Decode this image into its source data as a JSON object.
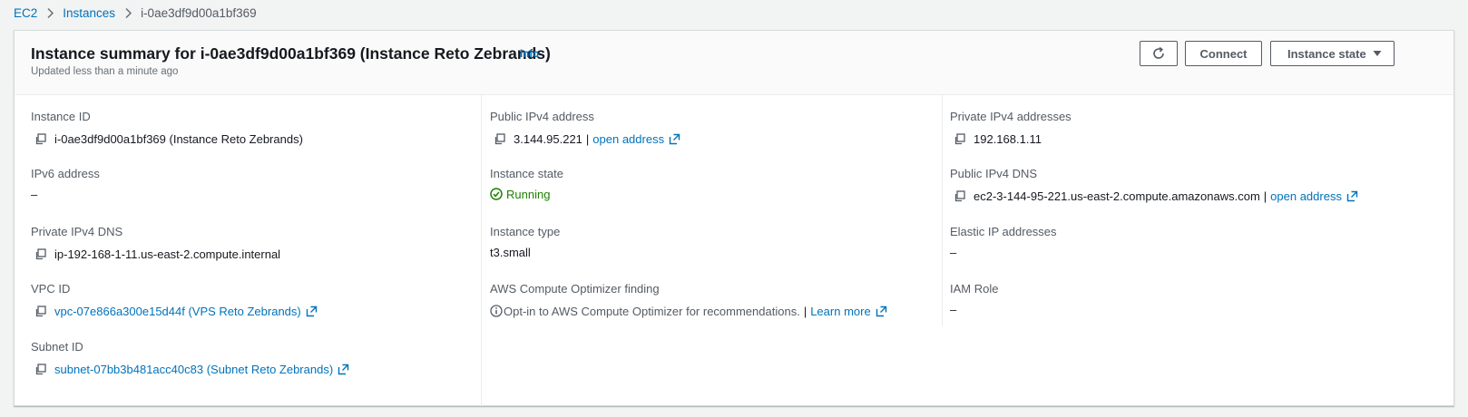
{
  "breadcrumb": {
    "items": [
      {
        "label": "EC2"
      },
      {
        "label": "Instances"
      }
    ],
    "current": "i-0ae3df9d00a1bf369"
  },
  "header": {
    "title": "Instance summary for i-0ae3df9d00a1bf369 (Instance Reto Zebrands)",
    "info_label": "Info",
    "subtitle": "Updated less than a minute ago",
    "connect_label": "Connect",
    "instance_state_label": "Instance state"
  },
  "details": {
    "instance_id": {
      "label": "Instance ID",
      "value": "i-0ae3df9d00a1bf369 (Instance Reto Zebrands)"
    },
    "ipv6": {
      "label": "IPv6 address",
      "value": "–"
    },
    "private_dns": {
      "label": "Private IPv4 DNS",
      "value": "ip-192-168-1-11.us-east-2.compute.internal"
    },
    "vpc": {
      "label": "VPC ID",
      "value": "vpc-07e866a300e15d44f (VPS Reto Zebrands)"
    },
    "subnet": {
      "label": "Subnet ID",
      "value": "subnet-07bb3b481acc40c83 (Subnet Reto Zebrands)"
    },
    "public_ipv4": {
      "label": "Public IPv4 address",
      "value": "3.144.95.221",
      "separator": "|",
      "link": "open address"
    },
    "instance_state": {
      "label": "Instance state",
      "value": "Running"
    },
    "instance_type": {
      "label": "Instance type",
      "value": "t3.small"
    },
    "optimizer": {
      "label": "AWS Compute Optimizer finding",
      "value": "Opt-in to AWS Compute Optimizer for recommendations.",
      "separator": "|",
      "link": "Learn more"
    },
    "private_ipv4": {
      "label": "Private IPv4 addresses",
      "value": "192.168.1.11"
    },
    "public_dns": {
      "label": "Public IPv4 DNS",
      "value": "ec2-3-144-95-221.us-east-2.compute.amazonaws.com",
      "separator": "|",
      "link": "open address"
    },
    "elastic_ip": {
      "label": "Elastic IP addresses",
      "value": "–"
    },
    "iam_role": {
      "label": "IAM Role",
      "value": "–"
    }
  },
  "icons": {
    "chevron": "chevron-right-icon",
    "refresh": "refresh-icon",
    "caret": "caret-down-icon",
    "copy": "copy-icon",
    "external": "external-link-icon",
    "status": "status-check-icon",
    "info": "info-circle-icon"
  },
  "colors": {
    "link": "#0073bb",
    "running": "#1d8102",
    "text": "#16191f",
    "label": "#545b64",
    "background": "#f2f3f3"
  }
}
